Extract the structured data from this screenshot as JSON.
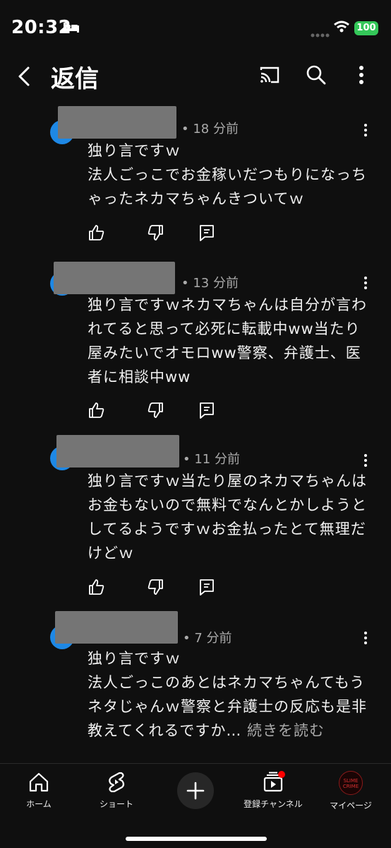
{
  "status": {
    "time": "20:32",
    "battery": "100"
  },
  "header": {
    "title": "返信"
  },
  "comments": [
    {
      "time": "• 18 分前",
      "text": "独り言ですｗ\n法人ごっこでお金稼いだつもりになっちゃったネカマちゃんきついてｗ"
    },
    {
      "time": "• 13 分前",
      "text": "独り言ですｗネカマちゃんは自分が言われてると思って必死に転載中ww当たり屋みたいでオモロww警察、弁護士、医者に相談中ww"
    },
    {
      "time": "• 11 分前",
      "text": "独り言ですｗ当たり屋のネカマちゃんはお金もないので無料でなんとかしようとしてるようですｗお金払ったとて無理だけどｗ"
    },
    {
      "time": "• 7 分前",
      "text": "独り言ですｗ\n法人ごっこのあとはネカマちゃんてもうネタじゃんｗ警察と弁護士の反応も是非教えてくれるですか…",
      "more": "続きを読む"
    }
  ],
  "nav": {
    "home": "ホーム",
    "shorts": "ショート",
    "subscriptions": "登録チャンネル",
    "mypage": "マイページ",
    "avatar_text": "SLIME CRIME"
  },
  "icons": {
    "back": "chevron-left-icon",
    "cast": "cast-icon",
    "search": "search-icon",
    "more": "more-vert-icon",
    "like": "thumb-up-icon",
    "dislike": "thumb-down-icon",
    "reply": "reply-icon"
  },
  "colors": {
    "background": "#0f0f0f",
    "text": "#f1f1f1",
    "meta": "#aaaaaa",
    "avatar": "#1e88e5",
    "accent_red": "#ff0000"
  }
}
